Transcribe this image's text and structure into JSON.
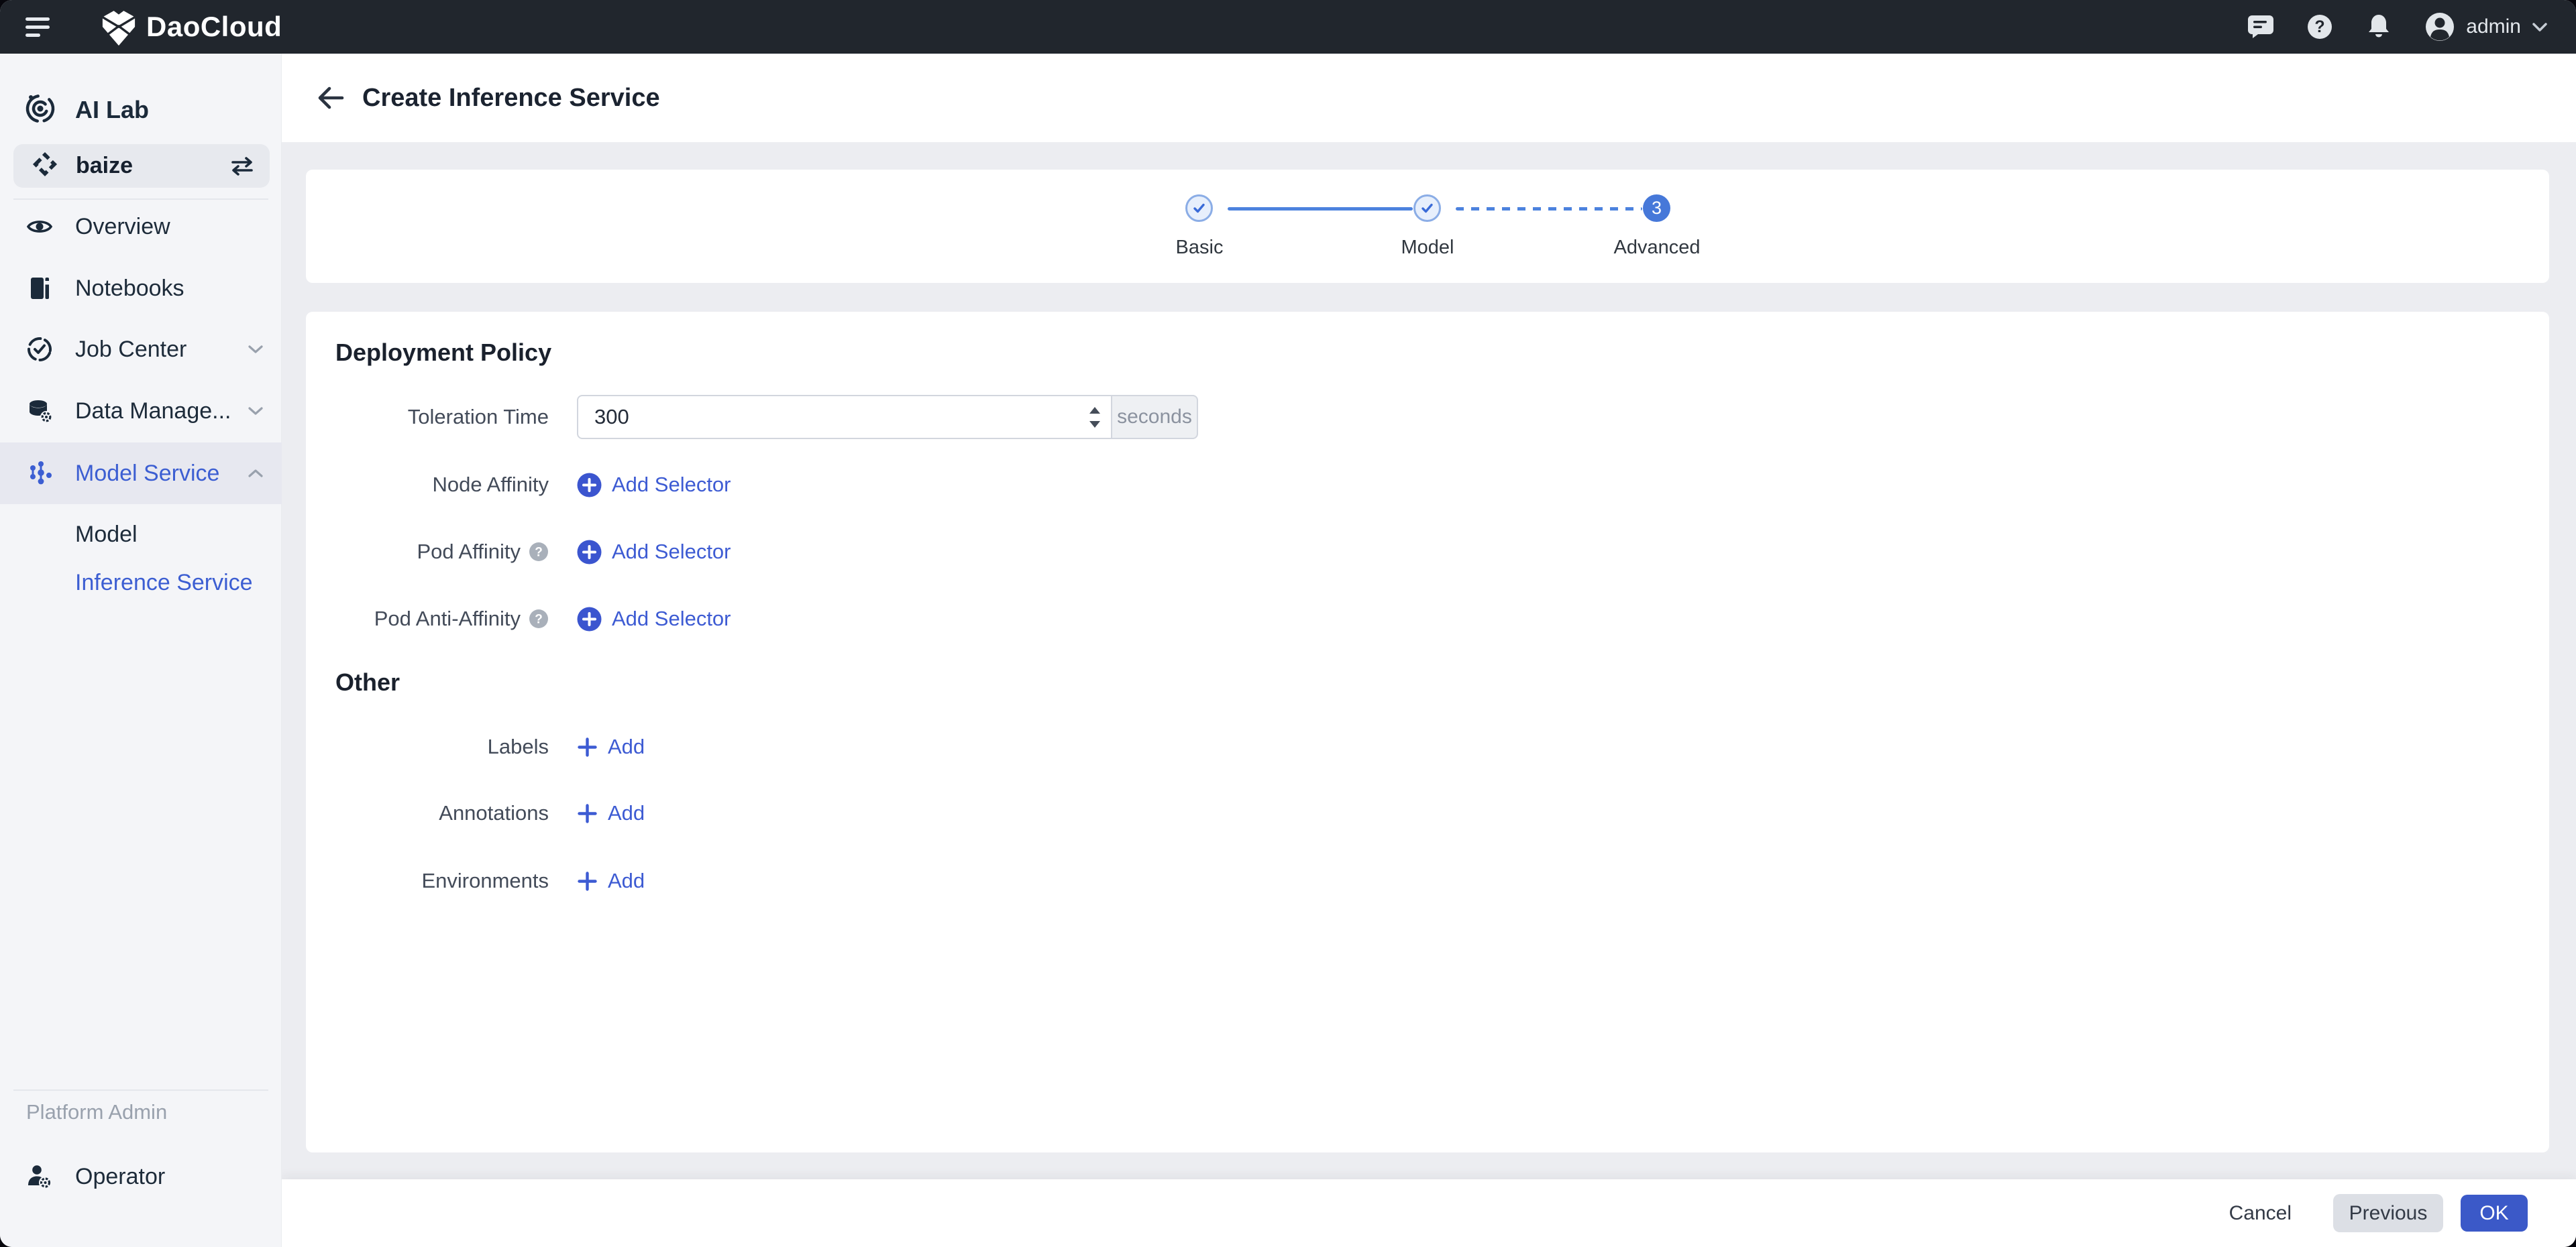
{
  "topbar": {
    "brand": "DaoCloud",
    "user": "admin"
  },
  "sidebar": {
    "module": "AI Lab",
    "workspace": "baize",
    "items": [
      {
        "label": "Overview"
      },
      {
        "label": "Notebooks"
      },
      {
        "label": "Job Center"
      },
      {
        "label": "Data Manage..."
      },
      {
        "label": "Model Service"
      },
      {
        "label": "Model"
      },
      {
        "label": "Inference Service"
      }
    ],
    "section_label": "Platform Admin",
    "operator": "Operator"
  },
  "header": {
    "title": "Create Inference Service"
  },
  "stepper": {
    "steps": [
      {
        "label": "Basic",
        "state": "done"
      },
      {
        "label": "Model",
        "state": "done"
      },
      {
        "label": "Advanced",
        "state": "current",
        "number": "3"
      }
    ]
  },
  "form": {
    "deployment": {
      "title": "Deployment Policy",
      "toleration": {
        "label": "Toleration Time",
        "value": "300",
        "unit": "seconds"
      },
      "rows": [
        {
          "label": "Node Affinity",
          "action": "Add Selector"
        },
        {
          "label": "Pod Affinity",
          "action": "Add Selector"
        },
        {
          "label": "Pod Anti-Affinity",
          "action": "Add Selector"
        }
      ]
    },
    "other": {
      "title": "Other",
      "rows": [
        {
          "label": "Labels",
          "action": "Add"
        },
        {
          "label": "Annotations",
          "action": "Add"
        },
        {
          "label": "Environments",
          "action": "Add"
        }
      ]
    }
  },
  "footer": {
    "cancel": "Cancel",
    "previous": "Previous",
    "ok": "OK"
  },
  "icons": {
    "hamburger-icon": "three-bars-menu",
    "brand-mark-icon": "daocloud-gem",
    "chat-icon": "speech-bubble",
    "help-icon": "question-circle",
    "bell-icon": "notification-bell",
    "avatar-icon": "user-circle",
    "chevron-down-icon": "v-caret",
    "ai-lab-icon": "concentric-target",
    "workspace-icon": "diamond-gem",
    "swap-icon": "switch-arrows",
    "eye-icon": "overview-eye",
    "book-icon": "notebook",
    "job-center-icon": "dashed-circle-check",
    "data-management-icon": "database-gear",
    "model-service-icon": "node-cluster",
    "operator-icon": "user-gear",
    "back-arrow-icon": "arrow-left",
    "check-icon": "step-complete-check",
    "plus-circle-icon": "filled-plus-circle",
    "plus-icon": "plus",
    "question-help-icon": "gray-question-circle",
    "spin-up-icon": "triangle-up",
    "spin-down-icon": "triangle-down"
  },
  "colors": {
    "topbar_bg": "#21262d",
    "accent_blue": "#3b59c8",
    "link_blue": "#3d5bd3",
    "active_blue": "#3c5ed2",
    "step_current": "#4678d9",
    "connector": "#4c82de",
    "sidebar_bg": "#f4f5f8",
    "main_bg": "#ecedf1",
    "previous_btn_bg": "#dcdfe5"
  }
}
